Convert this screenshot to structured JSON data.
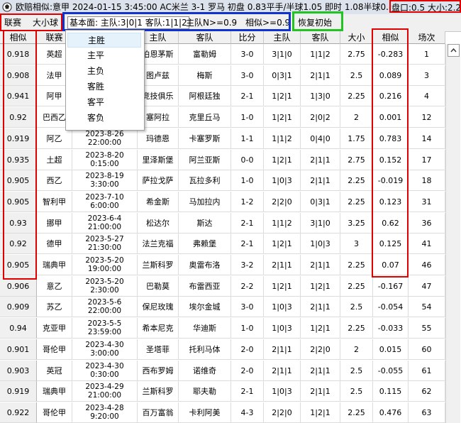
{
  "titlebar": {
    "title": "欧赔相似:意甲 2024-01-15 3:45:00 AC米兰 3-1 罗马 初盘 0.83平手/半球1.05 即时 1.08半球0.82",
    "odds": "盘口:0.5 大小:2.25"
  },
  "toolbar": {
    "league_label": "联赛",
    "bigsmall_label": "大小球",
    "fundamentals": "基本面: 主队:3|0|1 客队:1|1|2",
    "home_ge": "主队N>=0.9",
    "similar_ge": "相似>=0.9",
    "restore_label": "恢复初始"
  },
  "columns": [
    "相似",
    "联赛",
    "日期",
    "主队",
    "客队",
    "比分",
    "主队",
    "客队",
    "大小",
    "相似",
    "场次"
  ],
  "rows": [
    {
      "sim": "0.918",
      "league": "英超",
      "date": "",
      "time": "",
      "home": "伯恩茅斯",
      "away": "富勒姆",
      "score": "3-0",
      "hrec": "3|1|0",
      "arec": "1|1|2",
      "ou": "2.75",
      "sim2": "-0.283",
      "n": "1"
    },
    {
      "sim": "0.908",
      "league": "法甲",
      "date": "",
      "time": "",
      "home": "图卢兹",
      "away": "梅斯",
      "score": "3-0",
      "hrec": "0|3|1",
      "arec": "2|1|1",
      "ou": "2.5",
      "sim2": "0.089",
      "n": "3"
    },
    {
      "sim": "0.941",
      "league": "阿甲",
      "date": "",
      "time": "",
      "home": "竞技俱乐",
      "away": "阿根廷独",
      "score": "2-1",
      "hrec": "1|2|1",
      "arec": "1|3|0",
      "ou": "2.25",
      "sim2": "0.216",
      "n": "4"
    },
    {
      "sim": "0.92",
      "league": "巴西乙",
      "date": "",
      "time": "",
      "home": "塞阿拉",
      "away": "克里丘马",
      "score": "1-0",
      "hrec": "1|2|1",
      "arec": "2|0|2",
      "ou": "2",
      "sim2": "0.001",
      "n": "12"
    },
    {
      "sim": "0.919",
      "league": "阿乙",
      "date": "2023-8-26",
      "time": "22:00:00",
      "home": "玛德恩",
      "away": "卡塞罗斯",
      "score": "1-1",
      "hrec": "1|1|2",
      "arec": "0|4|0",
      "ou": "1.75",
      "sim2": "0.783",
      "n": "14"
    },
    {
      "sim": "0.935",
      "league": "土超",
      "date": "2023-8-20",
      "time": "0:15:00",
      "home": "里泽斯堡",
      "away": "阿兰亚斯",
      "score": "0-0",
      "hrec": "1|2|1",
      "arec": "2|1|1",
      "ou": "2.75",
      "sim2": "0.152",
      "n": "17"
    },
    {
      "sim": "0.905",
      "league": "西乙",
      "date": "2023-8-19",
      "time": "3:30:00",
      "home": "萨拉戈萨",
      "away": "瓦拉多利",
      "score": "1-0",
      "hrec": "1|0|3",
      "arec": "2|1|1",
      "ou": "2.25",
      "sim2": "-0.019",
      "n": "18"
    },
    {
      "sim": "0.905",
      "league": "智利甲",
      "date": "2023-7-10",
      "time": "6:00:00",
      "home": "希金斯",
      "away": "马加拉内",
      "score": "1-2",
      "hrec": "2|2|0",
      "arec": "0|3|1",
      "ou": "2.25",
      "sim2": "0.123",
      "n": "31"
    },
    {
      "sim": "0.93",
      "league": "挪甲",
      "date": "2023-6-4",
      "time": "21:00:00",
      "home": "松达尔",
      "away": "斯达",
      "score": "2-1",
      "hrec": "1|1|2",
      "arec": "3|1|0",
      "ou": "3.25",
      "sim2": "0.62",
      "n": "36"
    },
    {
      "sim": "0.92",
      "league": "德甲",
      "date": "2023-5-27",
      "time": "21:30:00",
      "home": "法兰克福",
      "away": "弗赖堡",
      "score": "2-1",
      "hrec": "1|2|1",
      "arec": "1|0|3",
      "ou": "3",
      "sim2": "0.125",
      "n": "41"
    },
    {
      "sim": "0.905",
      "league": "瑞典甲",
      "date": "2023-5-20",
      "time": "19:00:00",
      "home": "兰斯科罗",
      "away": "奥雷布洛",
      "score": "3-2",
      "hrec": "2|1|1",
      "arec": "2|1|1",
      "ou": "2.25",
      "sim2": "0.07",
      "n": "46"
    },
    {
      "sim": "0.906",
      "league": "意乙",
      "date": "2023-5-20",
      "time": "2:30:00",
      "home": "巴勒莫",
      "away": "布雷西亚",
      "score": "2-2",
      "hrec": "1|2|1",
      "arec": "1|2|1",
      "ou": "2.25",
      "sim2": "-0.167",
      "n": "47"
    },
    {
      "sim": "0.909",
      "league": "苏乙",
      "date": "2023-5-6",
      "time": "22:00:00",
      "home": "保尼玫瑰",
      "away": "埃尔金城",
      "score": "3-0",
      "hrec": "1|0|3",
      "arec": "2|1|1",
      "ou": "2.5",
      "sim2": "-0.054",
      "n": "54"
    },
    {
      "sim": "0.94",
      "league": "克亚甲",
      "date": "2023-5-5",
      "time": "23:59:00",
      "home": "希本尼克",
      "away": "华迪斯",
      "score": "1-0",
      "hrec": "1|0|3",
      "arec": "1|2|1",
      "ou": "2.25",
      "sim2": "-0.033",
      "n": "55"
    },
    {
      "sim": "0.901",
      "league": "哥伦甲",
      "date": "2023-4-30",
      "time": "3:00:00",
      "home": "圣塔菲",
      "away": "托利马体",
      "score": "2-0",
      "hrec": "2|1|1",
      "arec": "2|2|0",
      "ou": "2",
      "sim2": "0.015",
      "n": "60"
    },
    {
      "sim": "0.903",
      "league": "英冠",
      "date": "2023-4-30",
      "time": "0:30:00",
      "home": "西布罗姆",
      "away": "诺维奇",
      "score": "2-0",
      "hrec": "2|1|1",
      "arec": "2|1|1",
      "ou": "2.5",
      "sim2": "-0.055",
      "n": "61"
    },
    {
      "sim": "0.919",
      "league": "瑞典甲",
      "date": "2023-4-29",
      "time": "21:00:00",
      "home": "兰斯科罗",
      "away": "耶夫勒",
      "score": "2-1",
      "hrec": "1|0|3",
      "arec": "2|1|1",
      "ou": "2.5",
      "sim2": "0.115",
      "n": "62"
    },
    {
      "sim": "0.922",
      "league": "哥伦甲",
      "date": "2023-4-28",
      "time": "9:20:00",
      "home": "百万富翁",
      "away": "卡利阿美",
      "score": "4-3",
      "hrec": "2|2|0",
      "arec": "1|2|1",
      "ou": "2.25",
      "sim2": "0.476",
      "n": "63"
    }
  ],
  "menu": [
    "主胜",
    "主平",
    "主负",
    "客胜",
    "客平",
    "客负"
  ]
}
